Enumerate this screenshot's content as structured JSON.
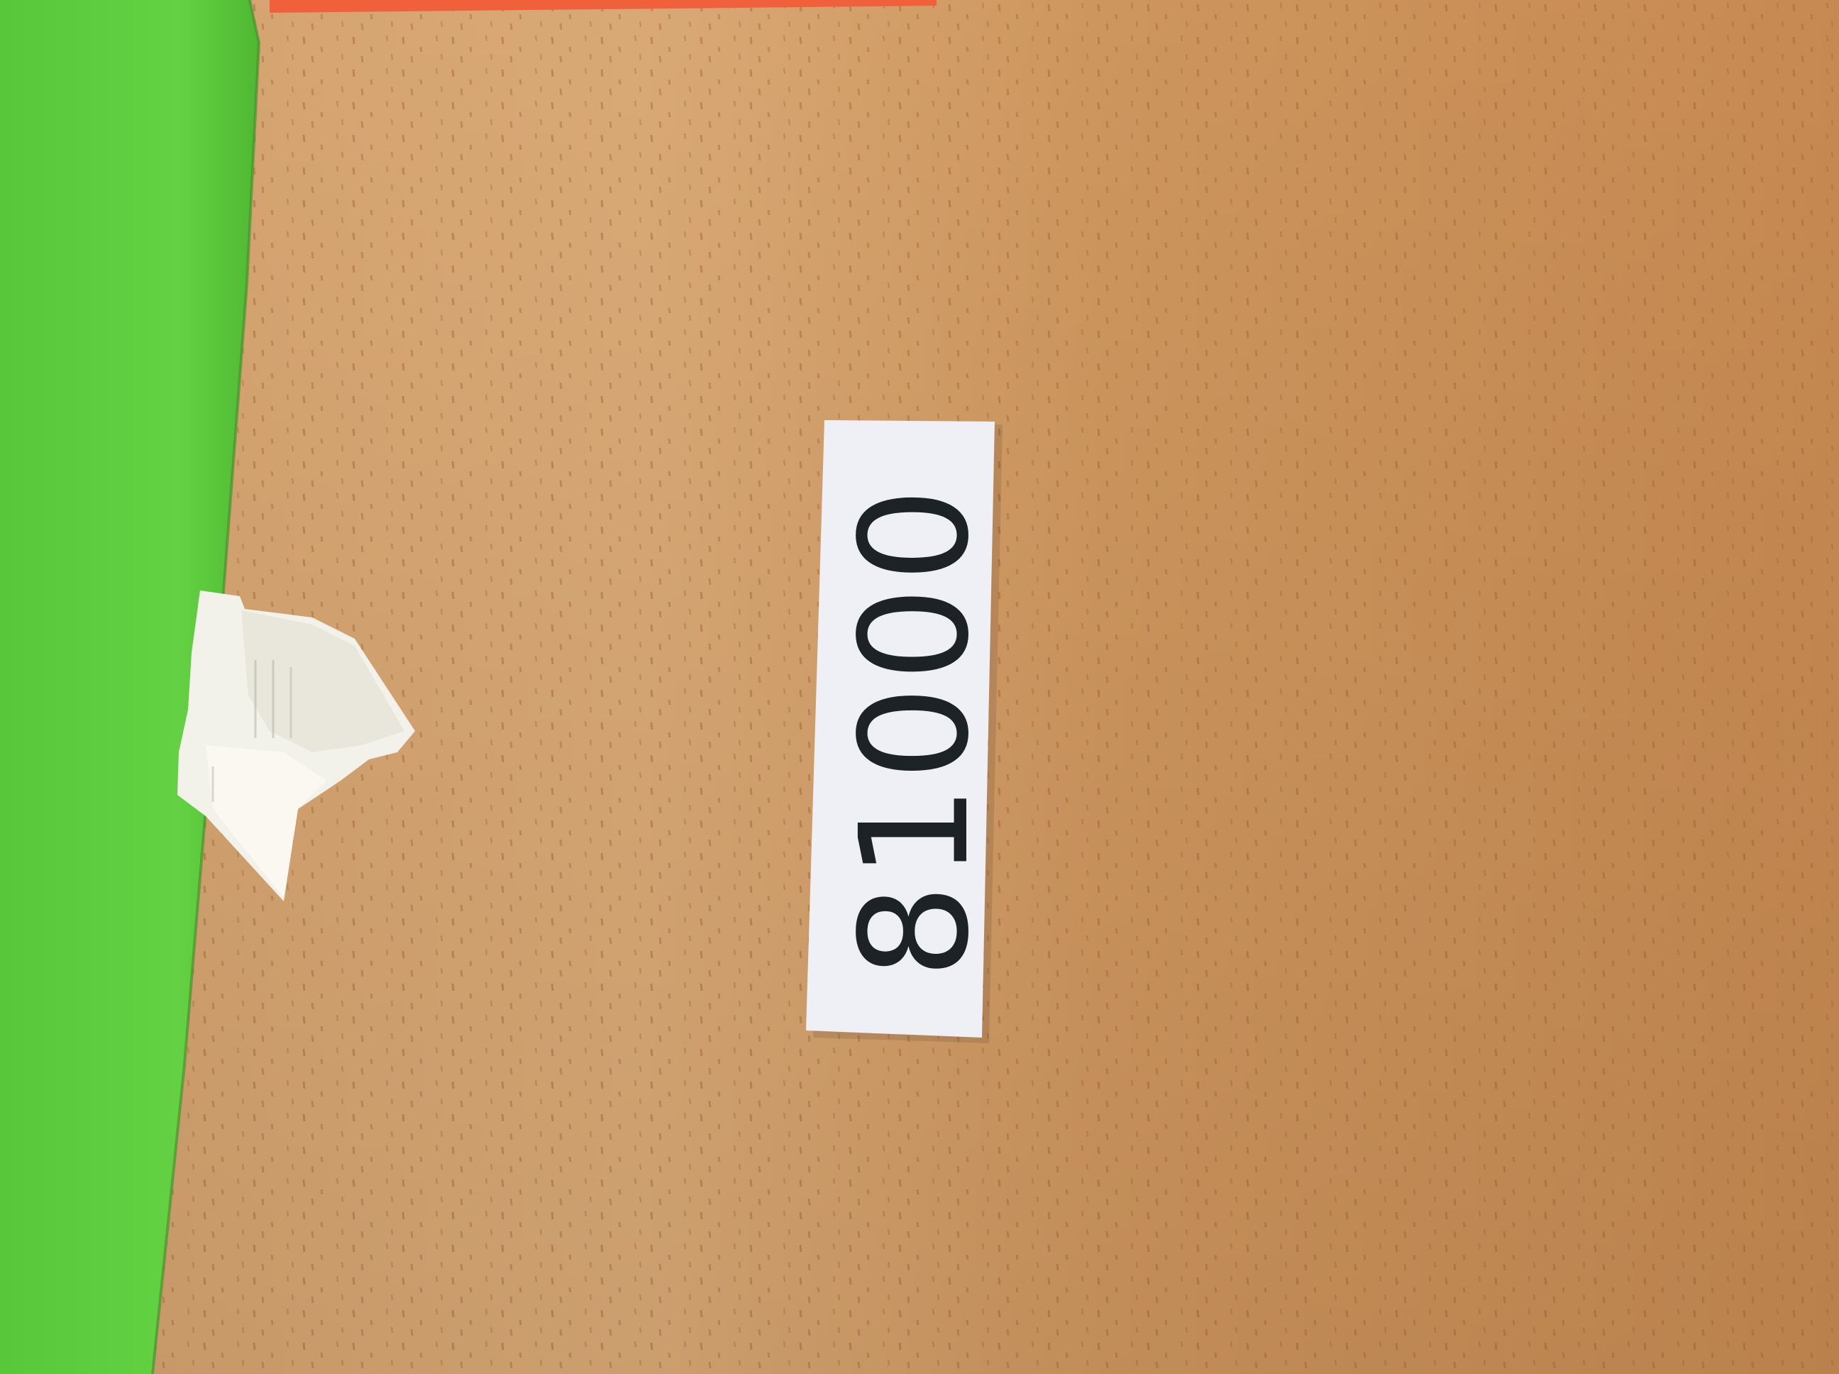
{
  "label": {
    "text": "81000",
    "paper_color": "#eef0f5",
    "ink_color": "#1d2227"
  },
  "colors": {
    "table_wood": "#d49a62",
    "table_wood_light": "#e1ae78",
    "green_sheet": "#5fce3e",
    "orange_strip": "#f0603a",
    "torn_paper": "#f2f2ea"
  }
}
